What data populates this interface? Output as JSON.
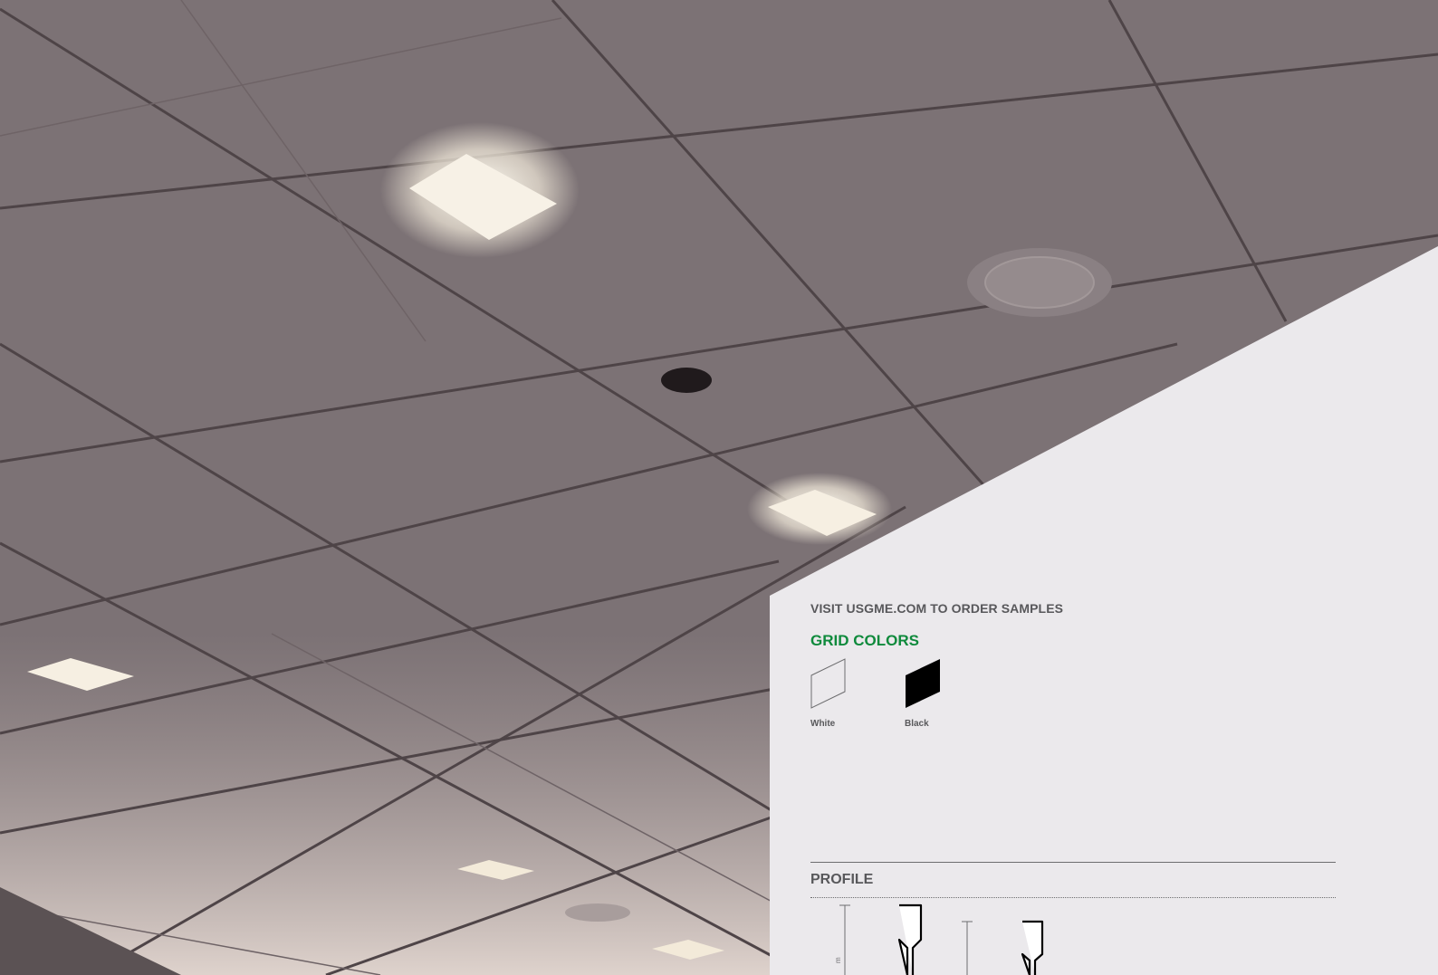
{
  "colors": {
    "panel_background": "#ebe9ec",
    "heading_gray": "#58585b",
    "accent_green": "#0f8a3c",
    "ceiling_tile": "#7c7275",
    "grid_line": "#4e4447"
  },
  "photo": {
    "subject": "suspended ceiling with grid, square light fixtures and round diffuser",
    "icons": [
      "ceiling-photo"
    ]
  },
  "samples_cta": "VISIT USGME.COM TO ORDER SAMPLES",
  "grid_colors": {
    "title": "GRID COLORS",
    "swatches": [
      {
        "label": "White",
        "color": "#ebe9ec"
      },
      {
        "label": "Black",
        "color": "#000000"
      }
    ]
  },
  "profile": {
    "title": "PROFILE",
    "dimension_fragment": "m",
    "icons": [
      "tee-profile-icon"
    ]
  }
}
